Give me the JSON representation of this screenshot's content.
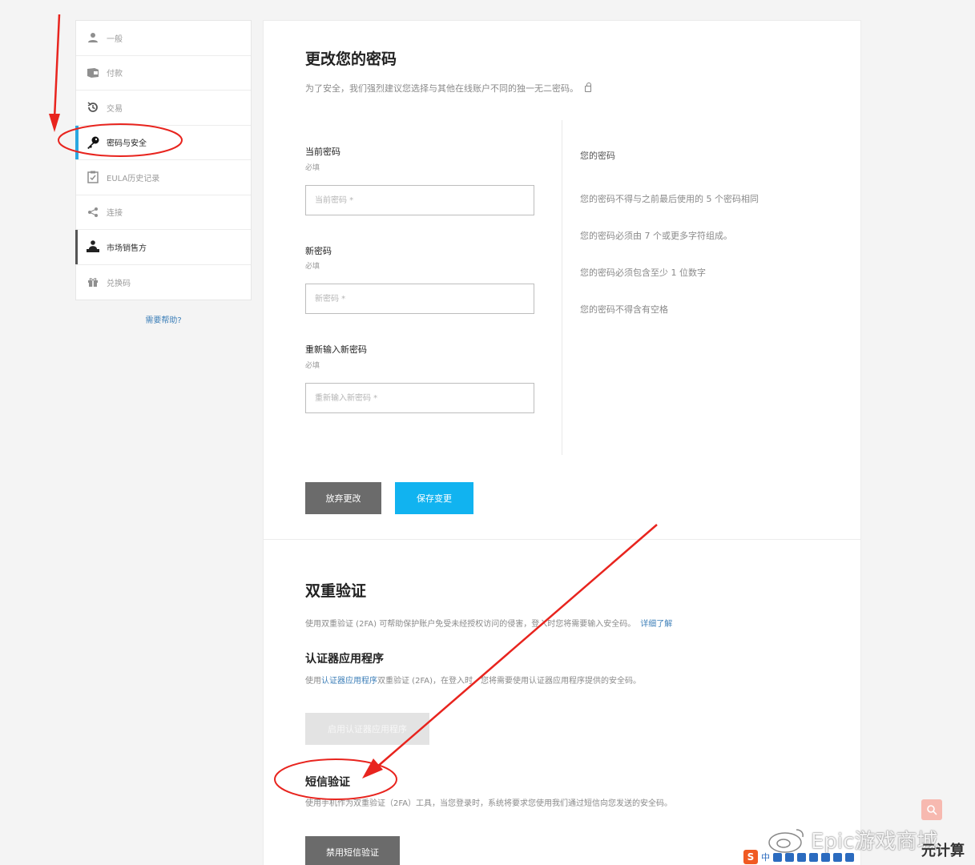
{
  "sidebar": {
    "items": [
      {
        "label": "一般",
        "icon": "person-icon"
      },
      {
        "label": "付款",
        "icon": "payment-icon"
      },
      {
        "label": "交易",
        "icon": "history-icon"
      },
      {
        "label": "密码与安全",
        "icon": "key-icon",
        "active": true
      },
      {
        "label": "EULA历史记录",
        "icon": "clipboard-check-icon"
      },
      {
        "label": "连接",
        "icon": "share-icon"
      },
      {
        "label": "市场销售方",
        "icon": "seller-icon"
      },
      {
        "label": "兑换码",
        "icon": "gift-icon"
      }
    ],
    "help_link": "需要帮助?"
  },
  "password": {
    "title": "更改您的密码",
    "subtitle": "为了安全，我们强烈建议您选择与其他在线账户不同的独一无二密码。",
    "fields": [
      {
        "label": "当前密码",
        "required": "必填",
        "placeholder": "当前密码 *"
      },
      {
        "label": "新密码",
        "required": "必填",
        "placeholder": "新密码 *"
      },
      {
        "label": "重新输入新密码",
        "required": "必填",
        "placeholder": "重新输入新密码 *"
      }
    ],
    "rules_title": "您的密码",
    "rules": [
      "您的密码不得与之前最后使用的 5 个密码相同",
      "您的密码必须由 7 个或更多字符组成。",
      "您的密码必须包含至少 1 位数字",
      "您的密码不得含有空格"
    ],
    "discard_label": "放弃更改",
    "save_label": "保存变更"
  },
  "twofa": {
    "title": "双重验证",
    "description": "使用双重验证 (2FA) 可帮助保护账户免受未经授权访问的侵害，登入时您将需要输入安全码。",
    "learn_more": "详细了解",
    "authenticator": {
      "title": "认证器应用程序",
      "desc_prefix": "使用",
      "desc_link": "认证器应用程序",
      "desc_suffix": "双重验证 (2FA)，在登入时，您将需要使用认证器应用程序提供的安全码。",
      "button": "启用认证器应用程序"
    },
    "sms": {
      "title": "短信验证",
      "desc": "使用手机作为双重验证（2FA）工具，当您登录时，系统将要求您使用我们通过短信向您发送的安全码。",
      "button": "禁用短信验证"
    }
  },
  "watermark": {
    "text": "Epic游戏商城",
    "subtext": "元计算"
  },
  "tray": {
    "ime_label": "中",
    "ime_icon": "sogou-icon"
  },
  "colors": {
    "accent": "#11b3f0",
    "active_bar": "#2aa7e0",
    "annotation": "#e8241e",
    "link": "#3d7fb8",
    "dark_button": "#6b6b6b"
  }
}
